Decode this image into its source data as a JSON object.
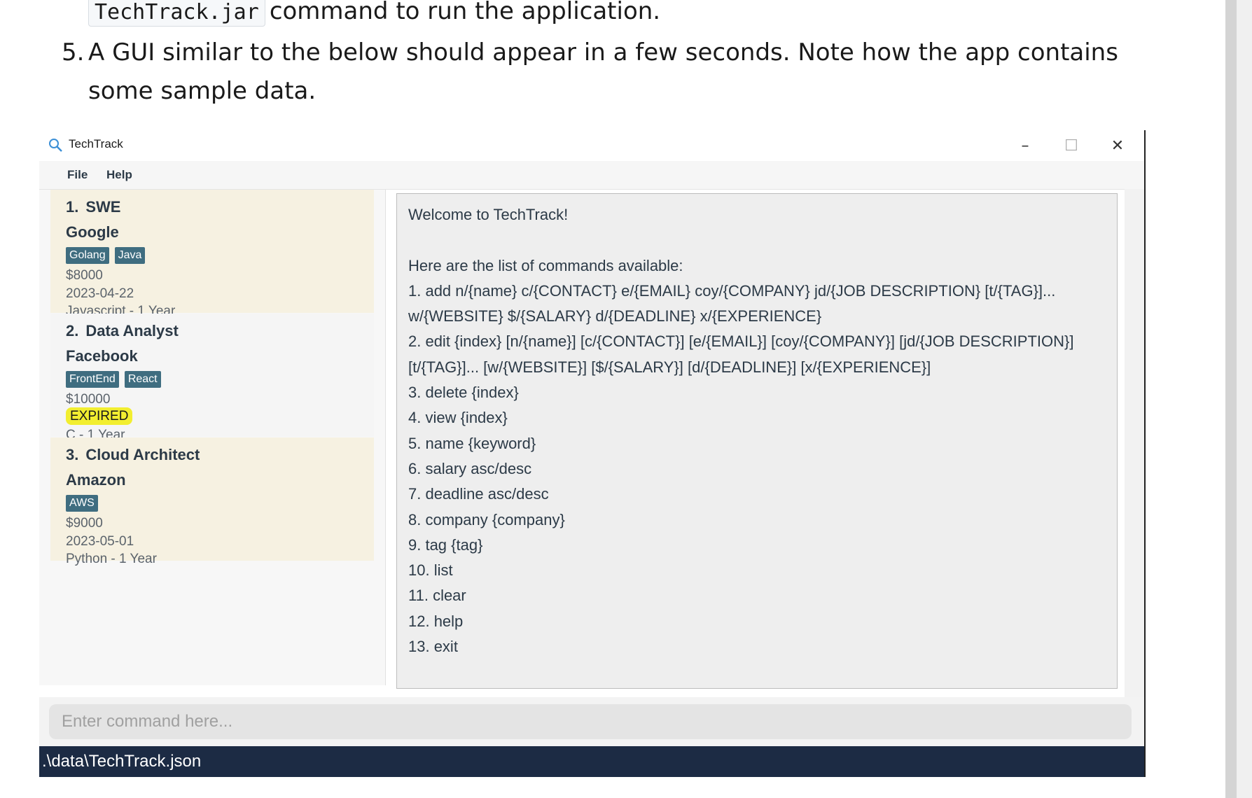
{
  "document": {
    "line1_code": "TechTrack.jar",
    "line1_rest": "command to run the application.",
    "step_number": "5.",
    "step_text": "A GUI similar to the below should appear in a few seconds. Note how the app contains some sample data."
  },
  "window": {
    "title": "TechTrack",
    "controls": {
      "minimize": "–",
      "maximize": "☐",
      "close": "✕"
    }
  },
  "menu": {
    "file": "File",
    "help": "Help"
  },
  "jobs": [
    {
      "index": "1.",
      "title": "SWE",
      "company": "Google",
      "tags": [
        "Golang",
        "Java"
      ],
      "salary": "$8000",
      "deadline": "2023-04-22",
      "expired": false,
      "experience": "Javascript - 1 Year"
    },
    {
      "index": "2.",
      "title": "Data Analyst",
      "company": "Facebook",
      "tags": [
        "FrontEnd",
        "React"
      ],
      "salary": "$10000",
      "deadline": "EXPIRED",
      "expired": true,
      "experience": "C - 1 Year"
    },
    {
      "index": "3.",
      "title": "Cloud Architect",
      "company": "Amazon",
      "tags": [
        "AWS"
      ],
      "salary": "$9000",
      "deadline": "2023-05-01",
      "expired": false,
      "experience": "Python - 1 Year"
    }
  ],
  "result_display": {
    "text": "Welcome to TechTrack!\n\nHere are the list of commands available:\n1. add n/{name} c/{CONTACT} e/{EMAIL} coy/{COMPANY} jd/{JOB DESCRIPTION} [t/{TAG}]...\nw/{WEBSITE} $/{SALARY} d/{DEADLINE} x/{EXPERIENCE}\n2. edit {index} [n/{name}] [c/{CONTACT}] [e/{EMAIL}] [coy/{COMPANY}] [jd/{JOB DESCRIPTION}]\n[t/{TAG}]... [w/{WEBSITE}] [$/{SALARY}] [d/{DEADLINE}] [x/{EXPERIENCE}]\n3. delete {index}\n4. view {index}\n5. name {keyword}\n6. salary asc/desc\n7. deadline asc/desc\n8. company {company}\n9. tag {tag}\n10. list\n11. clear\n12. help\n13. exit"
  },
  "command_box": {
    "placeholder": "Enter command here...",
    "value": ""
  },
  "status_bar": {
    "path": ".\\data\\TechTrack.json"
  },
  "colors": {
    "tag_bg": "#3f6d80",
    "card_alt_bg": "#f6f1e1",
    "expired_bg": "#f2ee30",
    "status_bg": "#1c2b44"
  }
}
